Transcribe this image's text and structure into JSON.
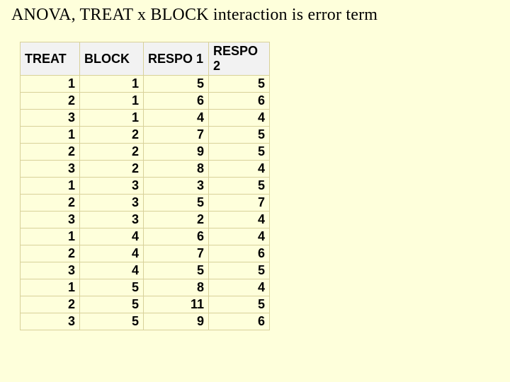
{
  "title": "ANOVA, TREAT x BLOCK interaction is error term",
  "table": {
    "columns": [
      "TREAT",
      "BLOCK",
      "RESPO 1",
      "RESPO 2"
    ],
    "rows": [
      {
        "treat": 1,
        "block": 1,
        "respo1": 5,
        "respo2": 5
      },
      {
        "treat": 2,
        "block": 1,
        "respo1": 6,
        "respo2": 6
      },
      {
        "treat": 3,
        "block": 1,
        "respo1": 4,
        "respo2": 4
      },
      {
        "treat": 1,
        "block": 2,
        "respo1": 7,
        "respo2": 5
      },
      {
        "treat": 2,
        "block": 2,
        "respo1": 9,
        "respo2": 5
      },
      {
        "treat": 3,
        "block": 2,
        "respo1": 8,
        "respo2": 4
      },
      {
        "treat": 1,
        "block": 3,
        "respo1": 3,
        "respo2": 5
      },
      {
        "treat": 2,
        "block": 3,
        "respo1": 5,
        "respo2": 7
      },
      {
        "treat": 3,
        "block": 3,
        "respo1": 2,
        "respo2": 4
      },
      {
        "treat": 1,
        "block": 4,
        "respo1": 6,
        "respo2": 4
      },
      {
        "treat": 2,
        "block": 4,
        "respo1": 7,
        "respo2": 6
      },
      {
        "treat": 3,
        "block": 4,
        "respo1": 5,
        "respo2": 5
      },
      {
        "treat": 1,
        "block": 5,
        "respo1": 8,
        "respo2": 4
      },
      {
        "treat": 2,
        "block": 5,
        "respo1": 11,
        "respo2": 5
      },
      {
        "treat": 3,
        "block": 5,
        "respo1": 9,
        "respo2": 6
      }
    ]
  }
}
